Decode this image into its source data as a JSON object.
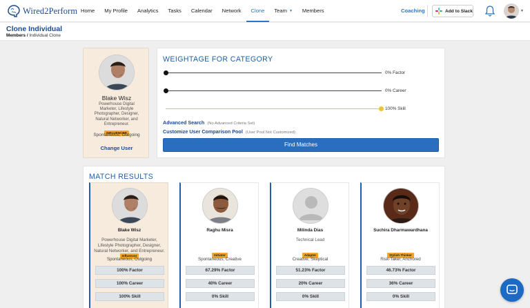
{
  "brand": {
    "name": "Wired2Perform"
  },
  "nav": {
    "links": [
      {
        "label": "Home"
      },
      {
        "label": "My Profile"
      },
      {
        "label": "Analytics"
      },
      {
        "label": "Tasks"
      },
      {
        "label": "Calendar"
      },
      {
        "label": "Network"
      },
      {
        "label": "Clone",
        "active": true
      },
      {
        "label": "Team"
      },
      {
        "label": "Members"
      }
    ],
    "coaching": "Coaching",
    "slack_button": "Add to Slack"
  },
  "header": {
    "title": "Clone Individual",
    "breadcrumb_parent": "Members /",
    "breadcrumb_current": "Individual Clone"
  },
  "profile": {
    "name": "Blake Wisz",
    "description": "Powerhouse Digital Marketer, Lifestyle Photographer, Designer, Natural Networker, and Entrepreneur.",
    "badge": "INFLUENCER",
    "traits": "Spontaneous, Outgoing",
    "change_user": "Change User"
  },
  "weightage": {
    "title": "WEIGHTAGE FOR CATEGORY",
    "sliders": [
      {
        "label": "0% Factor",
        "value": 0
      },
      {
        "label": "0% Career",
        "value": 0
      },
      {
        "label": "100% Skill",
        "value": 100
      }
    ],
    "advanced_search": "Advanced Search",
    "advanced_search_note": "(No Advanced Criteria Set)",
    "customize_pool": "Customize User Comparison Pool",
    "customize_pool_note": "(User Pool Not Customized)",
    "find_button": "Find Matches"
  },
  "results": {
    "title": "MATCH RESULTS",
    "matches": [
      {
        "name": "Blake Wisz",
        "title": "Powerhouse Digital Marketer, Lifestyle Photographer, Designer, Natural Networker, and Entrepreneur.",
        "badge": "Influencer",
        "traits": "Spontaneous, Outgoing",
        "factor": "100% Factor",
        "career": "100% Career",
        "skill": "100% Skill"
      },
      {
        "name": "Raghu Misra",
        "title": "",
        "badge": "Initiator",
        "traits": "Spontaneous, Creative",
        "factor": "67.29% Factor",
        "career": "40% Career",
        "skill": "0% Skill"
      },
      {
        "name": "Milinda Dias",
        "title": "Technical Lead",
        "badge": "Adapter",
        "traits": "Creative, Skeptical",
        "factor": "51.23% Factor",
        "career": "20% Career",
        "skill": "0% Skill"
      },
      {
        "name": "Suchira Dharmawardhana",
        "title": "",
        "badge": "Stylish Thinker",
        "traits": "Risk-Taker, Anchored",
        "factor": "46.73% Factor",
        "career": "36% Career",
        "skill": "0% Skill"
      }
    ]
  },
  "colors": {
    "brand_blue": "#1d4a88",
    "accent_blue": "#2a76c2",
    "badge_orange": "#f1a52b",
    "slider_yellow": "#f2c230"
  },
  "icons": {
    "bell": "bell-icon",
    "chat": "chat-icon",
    "slack": "slack-icon"
  }
}
